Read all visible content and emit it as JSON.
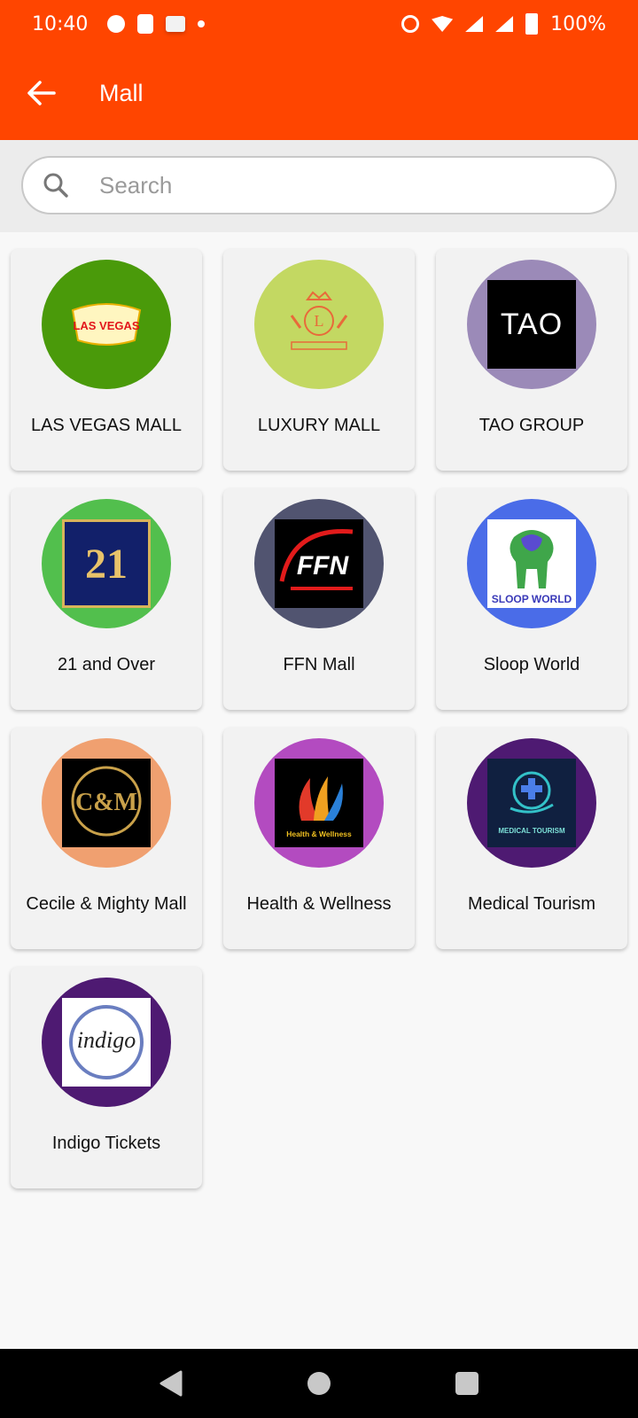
{
  "status_bar": {
    "time": "10:40",
    "battery": "100%"
  },
  "app_bar": {
    "title": "Mall"
  },
  "search": {
    "placeholder": "Search",
    "value": ""
  },
  "malls": [
    {
      "label": "LAS VEGAS MALL",
      "color": "#f5163c",
      "logo_text": "LAS VEGAS"
    },
    {
      "label": "LUXURY MALL",
      "color": "#4a9a0a",
      "logo_text": "L"
    },
    {
      "label": "TAO GROUP",
      "color": "#c3d862",
      "logo_text": "TAO"
    },
    {
      "label": "21 and Over",
      "color": "#9b8ab8",
      "logo_text": "21"
    },
    {
      "label": "FFN Mall",
      "color": "#52bf4d",
      "logo_text": "FFN"
    },
    {
      "label": "Sloop World",
      "color": "#515470",
      "logo_text": "SLOOP WORLD"
    },
    {
      "label": "Cecile & Mighty Mall",
      "color": "#4a6ce8",
      "logo_text": "C&M"
    },
    {
      "label": "Health & Wellness",
      "color": "#f0a070",
      "logo_text": "Health & Wellness"
    },
    {
      "label": "Medical Tourism",
      "color": "#b34bc0",
      "logo_text": "MEDICAL TOURISM"
    },
    {
      "label": "Indigo Tickets",
      "color": "#4e1a72",
      "logo_text": "indigo"
    }
  ],
  "colors": {
    "accent": "#ff4500",
    "nav": "#000000"
  }
}
